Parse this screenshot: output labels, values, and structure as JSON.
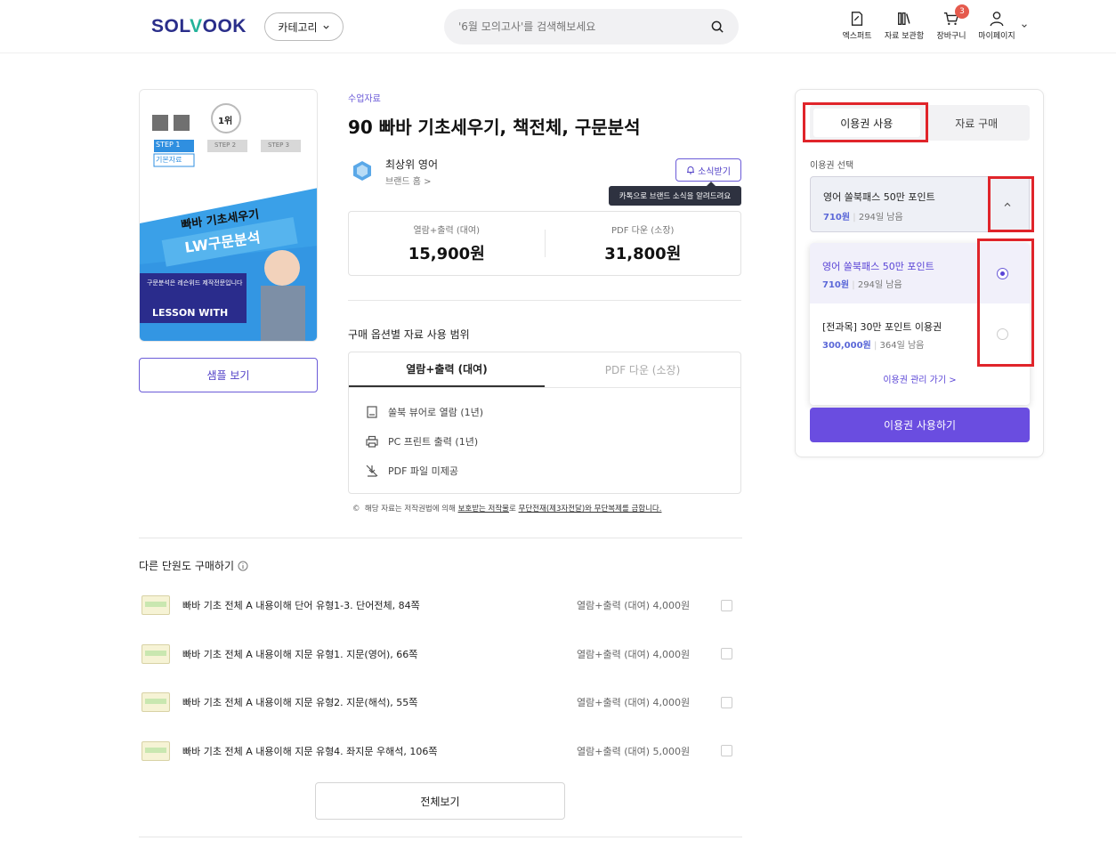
{
  "header": {
    "logo": {
      "part1": "SOL",
      "part2": "V",
      "part3": "OOK"
    },
    "category_label": "카테고리",
    "search_placeholder": "'6월 모의고사'를 검색해보세요",
    "icons": [
      {
        "label": "엑스퍼트",
        "icon": "pencil-doc-icon"
      },
      {
        "label": "자료 보관함",
        "icon": "library-icon"
      },
      {
        "label": "장바구니",
        "icon": "cart-icon",
        "badge": "3"
      },
      {
        "label": "마이페이지",
        "icon": "user-icon"
      }
    ]
  },
  "product": {
    "category": "수업자료",
    "title": "90 빠바 기초세우기, 책전체, 구문분석",
    "brand_name": "최상위 영어",
    "brand_home": "브랜드 홈 >",
    "notify_label": "소식받기",
    "tooltip": "카톡으로 브랜드 소식을 알려드려요",
    "sample_label": "샘플 보기",
    "prices": [
      {
        "label": "열람+출력 (대여)",
        "value": "15,900원"
      },
      {
        "label": "PDF 다운 (소장)",
        "value": "31,800원"
      }
    ]
  },
  "cover": {
    "step1": "STEP 1",
    "step1_sub": "기본자료",
    "step2": "STEP 2",
    "step3": "STEP 3",
    "rank": "1위",
    "headline1": "빠바 기초세우기",
    "headline2": "LW구문분석",
    "brand_text": "구문분석은 레슨위드 제작전문입니다",
    "lesson": "LESSON WITH",
    "accent_blue": "#2f8fe0",
    "navy": "#2a2c8c"
  },
  "usage_range": {
    "title": "구매 옵션별 자료 사용 범위",
    "tabs": [
      "열람+출력 (대여)",
      "PDF 다운 (소장)"
    ],
    "items": [
      {
        "icon": "book-icon",
        "label": "쏠북 뷰어로 열람 (1년)"
      },
      {
        "icon": "printer-icon",
        "label": "PC 프린트 출력 (1년)"
      },
      {
        "icon": "no-download-icon",
        "label": "PDF 파일 미제공"
      }
    ]
  },
  "copyright": {
    "symbol": "©",
    "text1": "해당 자료는 저작권법에 의해 ",
    "link1": "보호받는 저작물",
    "text2": "로 ",
    "link2": "무단전재(제3자전달)와 무단복제를 금합니다."
  },
  "other_units": {
    "title": "다른 단원도 구매하기",
    "items": [
      {
        "name": "빠바 기초 전체 A 내용이해 단어 유형1-3. 단어전체, 84쪽",
        "price": "열람+출력 (대여) 4,000원"
      },
      {
        "name": "빠바 기초 전체 A 내용이해 지문 유형1. 지문(영어), 66쪽",
        "price": "열람+출력 (대여) 4,000원"
      },
      {
        "name": "빠바 기초 전체 A 내용이해 지문 유형2. 지문(해석), 55쪽",
        "price": "열람+출력 (대여) 4,000원"
      },
      {
        "name": "빠바 기초 전체 A 내용이해 지문 유형4. 좌지문 우해석, 106쪽",
        "price": "열람+출력 (대여) 5,000원"
      }
    ],
    "view_all": "전체보기"
  },
  "purchase_panel": {
    "tabs": [
      "이용권 사용",
      "자료 구매"
    ],
    "select_label": "이용권 선택",
    "selected": {
      "name": "영어 쏠북패스 50만 포인트",
      "points": "710원",
      "days": "294일 남음"
    },
    "options": [
      {
        "name": "영어 쏠북패스 50만 포인트",
        "points": "710원",
        "days": "294일 남음",
        "checked": true
      },
      {
        "name": "[전과목] 30만 포인트 이용권",
        "points": "300,000원",
        "days": "364일 남음",
        "checked": false
      }
    ],
    "manage_link": "이용권 관리 가기 >",
    "use_button": "이용권 사용하기"
  },
  "colors": {
    "primary": "#6a4de0",
    "highlight": "#e0242a",
    "badge": "#e55a4d"
  }
}
